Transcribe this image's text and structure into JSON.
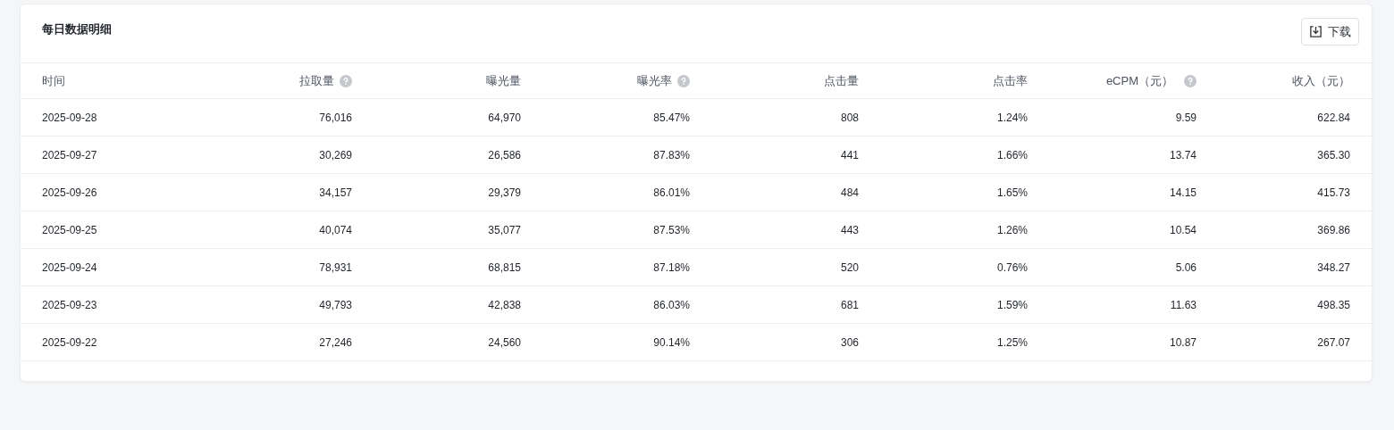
{
  "card": {
    "title": "每日数据明细",
    "download_button": "下载"
  },
  "table": {
    "columns": [
      {
        "label": "时间",
        "help": false
      },
      {
        "label": "拉取量",
        "help": true
      },
      {
        "label": "曝光量",
        "help": false
      },
      {
        "label": "曝光率",
        "help": true
      },
      {
        "label": "点击量",
        "help": false
      },
      {
        "label": "点击率",
        "help": false
      },
      {
        "label": "eCPM（元）",
        "help": true
      },
      {
        "label": "收入（元）",
        "help": false
      }
    ],
    "rows": [
      [
        "2025-09-28",
        "76,016",
        "64,970",
        "85.47%",
        "808",
        "1.24%",
        "9.59",
        "622.84"
      ],
      [
        "2025-09-27",
        "30,269",
        "26,586",
        "87.83%",
        "441",
        "1.66%",
        "13.74",
        "365.30"
      ],
      [
        "2025-09-26",
        "34,157",
        "29,379",
        "86.01%",
        "484",
        "1.65%",
        "14.15",
        "415.73"
      ],
      [
        "2025-09-25",
        "40,074",
        "35,077",
        "87.53%",
        "443",
        "1.26%",
        "10.54",
        "369.86"
      ],
      [
        "2025-09-24",
        "78,931",
        "68,815",
        "87.18%",
        "520",
        "0.76%",
        "5.06",
        "348.27"
      ],
      [
        "2025-09-23",
        "49,793",
        "42,838",
        "86.03%",
        "681",
        "1.59%",
        "11.63",
        "498.35"
      ],
      [
        "2025-09-22",
        "27,246",
        "24,560",
        "90.14%",
        "306",
        "1.25%",
        "10.87",
        "267.07"
      ]
    ]
  }
}
